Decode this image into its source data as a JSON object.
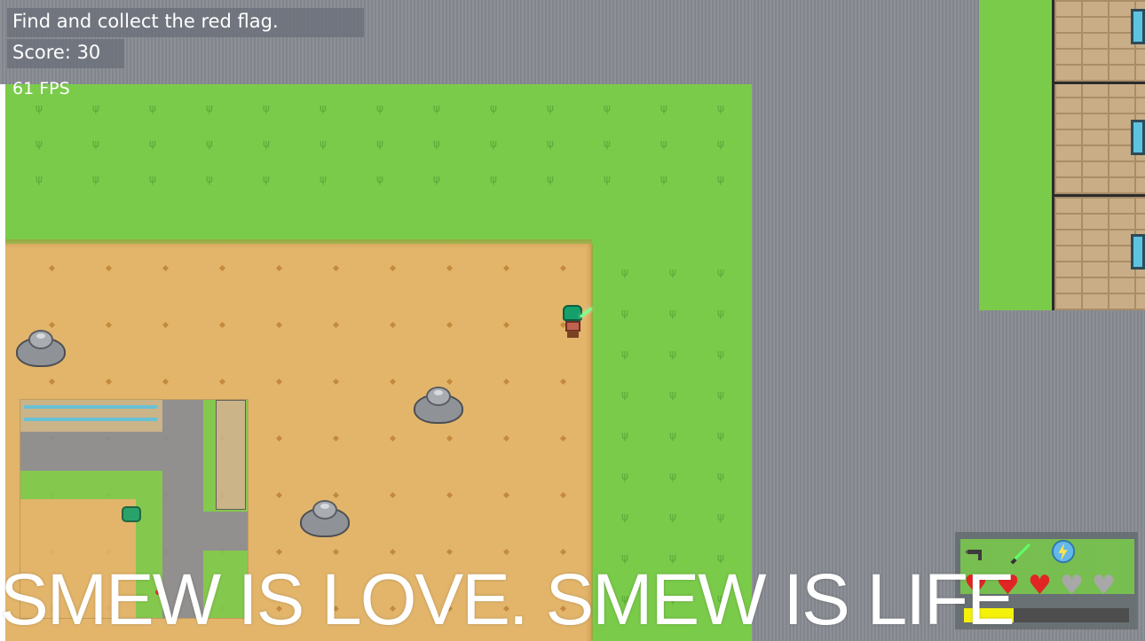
{
  "hud": {
    "objective": "Find and collect the red flag.",
    "score": "Score: 30",
    "fps": "61 FPS"
  },
  "caption": "SMEW IS LOVE. SMEW IS LIFE",
  "inventory": {
    "items": [
      "gun-icon",
      "green-sword-icon",
      "lightning-orb-icon"
    ],
    "hearts": {
      "full": 3,
      "empty": 2
    },
    "stamina_fraction": 0.3
  },
  "colors": {
    "grass": "#7acb4a",
    "dirt": "#e2b56b",
    "asphalt": "#8a8d93",
    "heart": "#e12525",
    "stamina": "#f4f20b"
  }
}
